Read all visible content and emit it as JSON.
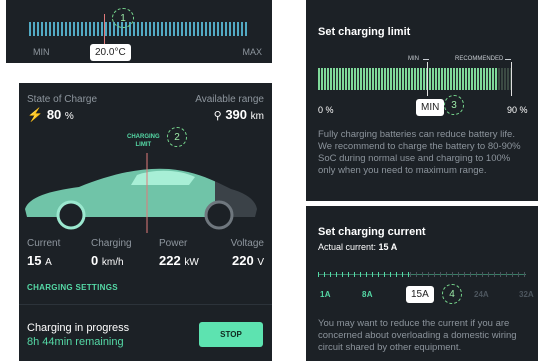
{
  "temperature": {
    "min_label": "MIN",
    "max_label": "MAX",
    "value": "20.0°C",
    "callout": "1"
  },
  "vehicle": {
    "soc_label": "State of Charge",
    "soc_value": "80",
    "soc_unit": "%",
    "range_label": "Available range",
    "range_value": "390",
    "range_unit": "km",
    "limit_label_line1": "CHARGING",
    "limit_label_line2": "LIMIT",
    "limit_callout": "2",
    "stats": [
      {
        "label": "Current",
        "value": "15",
        "unit": "A"
      },
      {
        "label": "Charging",
        "value": "0",
        "unit": "km/h"
      },
      {
        "label": "Power",
        "value": "222",
        "unit": "kW"
      },
      {
        "label": "Voltage",
        "value": "220",
        "unit": "V"
      }
    ],
    "settings_link": "CHARGING SETTINGS",
    "status_title": "Charging in progress",
    "status_remaining": "8h 44min remaining",
    "stop_label": "STOP",
    "colors": {
      "accent": "#55d9a6",
      "car_teal": "#7fe0c0"
    }
  },
  "charging_limit": {
    "title": "Set charging limit",
    "min_marker": "MIN",
    "recommended_marker": "RECOMMENDED",
    "left_label": "0 %",
    "right_label": "90 %",
    "pill": "MIN",
    "callout": "3",
    "description": "Fully charging batteries can reduce battery life. We recommend to charge the battery to 80-90% SoC during normal use and charging to 100% only when you need to maximum range."
  },
  "charging_current": {
    "title": "Set charging current",
    "actual_label": "Actual current:",
    "actual_value": "15 A",
    "scale": [
      "1A",
      "8A",
      "24A",
      "32A"
    ],
    "pill": "15A",
    "callout": "4",
    "description": "You may want to reduce the current if you are concerned about overloading a domestic wiring circuit shared by other equipment."
  }
}
